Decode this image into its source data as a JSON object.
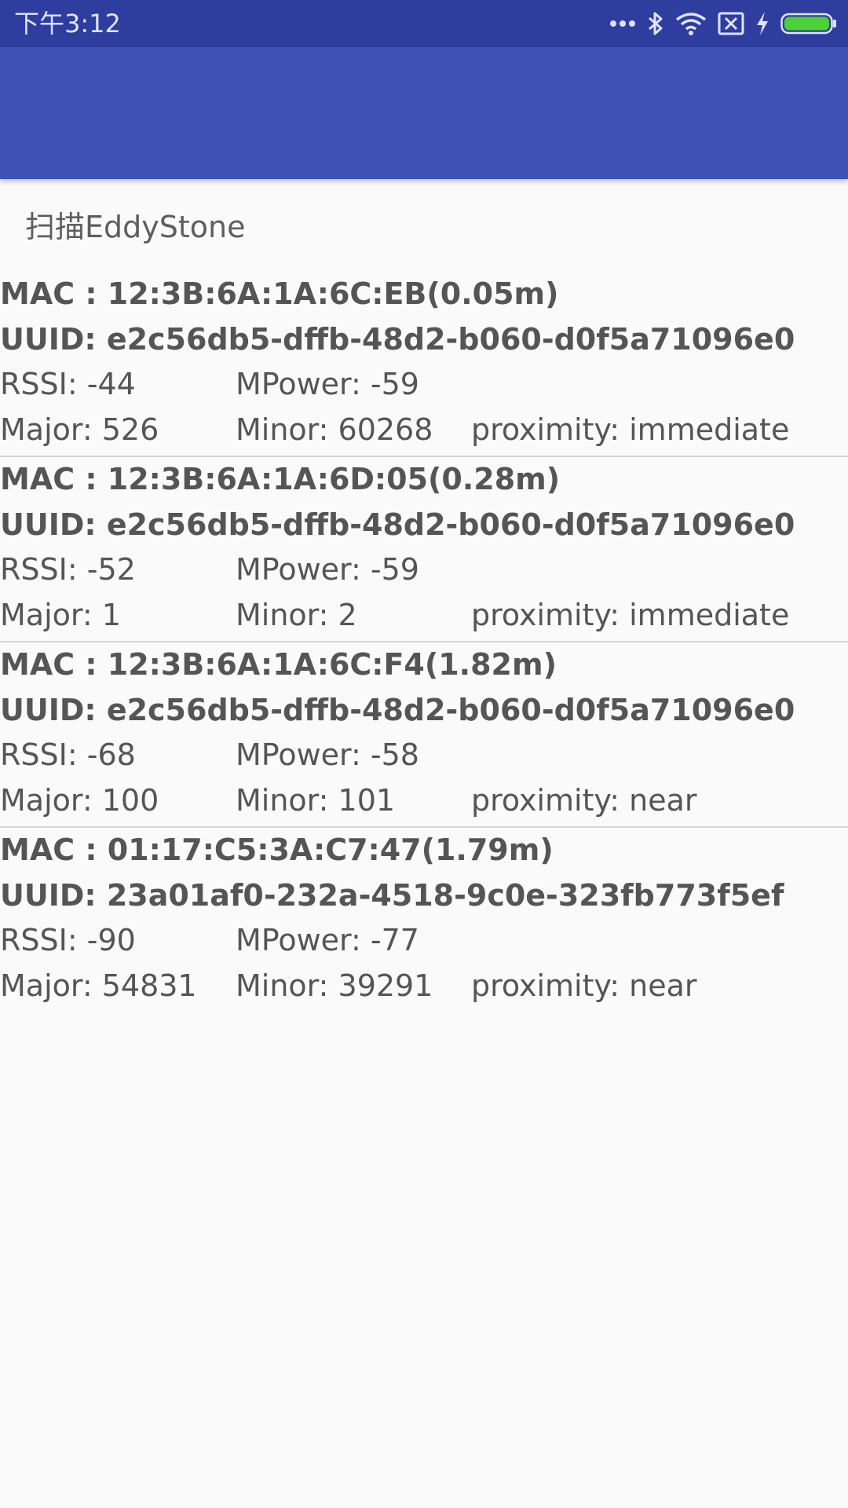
{
  "status_bar": {
    "time": "下午3:12",
    "icons": [
      "more-dots-icon",
      "bluetooth-icon",
      "wifi-icon",
      "no-sim-icon",
      "charging-icon",
      "battery-icon"
    ]
  },
  "colors": {
    "status_bar": "#2f3d9e",
    "app_bar": "#3f51b5",
    "battery": "#4cd137"
  },
  "scan_button": {
    "label": "扫描EddyStone"
  },
  "beacons": [
    {
      "mac": "MAC : 12:3B:6A:1A:6C:EB(0.05m)",
      "uuid": "UUID: e2c56db5-dffb-48d2-b060-d0f5a71096e0",
      "rssi": "RSSI: -44",
      "mpower": "MPower: -59",
      "major": "Major: 526",
      "minor": "Minor: 60268",
      "proximity": "proximity: immediate"
    },
    {
      "mac": "MAC : 12:3B:6A:1A:6D:05(0.28m)",
      "uuid": "UUID: e2c56db5-dffb-48d2-b060-d0f5a71096e0",
      "rssi": "RSSI: -52",
      "mpower": "MPower: -59",
      "major": "Major: 1",
      "minor": "Minor: 2",
      "proximity": "proximity: immediate"
    },
    {
      "mac": "MAC : 12:3B:6A:1A:6C:F4(1.82m)",
      "uuid": "UUID: e2c56db5-dffb-48d2-b060-d0f5a71096e0",
      "rssi": "RSSI: -68",
      "mpower": "MPower: -58",
      "major": "Major: 100",
      "minor": "Minor: 101",
      "proximity": "proximity: near"
    },
    {
      "mac": "MAC : 01:17:C5:3A:C7:47(1.79m)",
      "uuid": "UUID: 23a01af0-232a-4518-9c0e-323fb773f5ef",
      "rssi": "RSSI: -90",
      "mpower": "MPower: -77",
      "major": "Major: 54831",
      "minor": "Minor: 39291",
      "proximity": "proximity: near"
    }
  ]
}
